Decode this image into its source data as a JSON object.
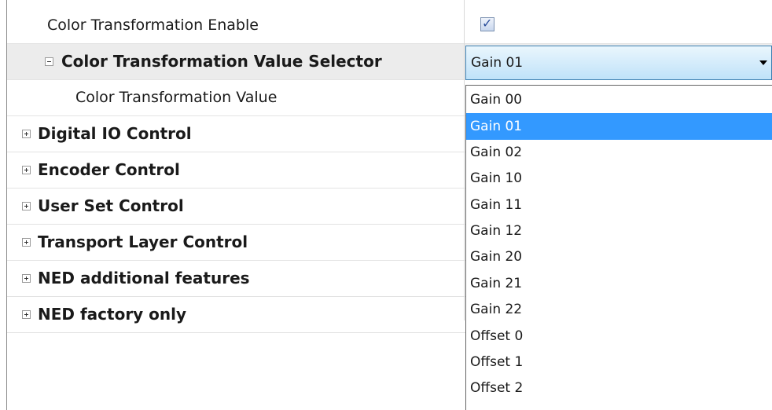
{
  "properties": {
    "rows": [
      {
        "label": "Color Transformation Enable"
      },
      {
        "label": "Color Transformation Value Selector"
      },
      {
        "label": "Color Transformation Value"
      },
      {
        "label": "Digital IO Control"
      },
      {
        "label": "Encoder Control"
      },
      {
        "label": "User Set Control"
      },
      {
        "label": "Transport Layer Control"
      },
      {
        "label": "NED additional features"
      },
      {
        "label": "NED factory only"
      }
    ],
    "enable_checked": true,
    "check_glyph": "✓"
  },
  "combo": {
    "value": "Gain 01"
  },
  "dropdown": {
    "options": [
      "Gain 00",
      "Gain 01",
      "Gain 02",
      "Gain 10",
      "Gain 11",
      "Gain 12",
      "Gain 20",
      "Gain 21",
      "Gain 22",
      "Offset 0",
      "Offset 1",
      "Offset 2"
    ],
    "highlighted": "Gain 01"
  },
  "colors": {
    "highlight": "#3399ff",
    "selected_row": "#ececec",
    "combo_border": "#3c7fb1"
  }
}
